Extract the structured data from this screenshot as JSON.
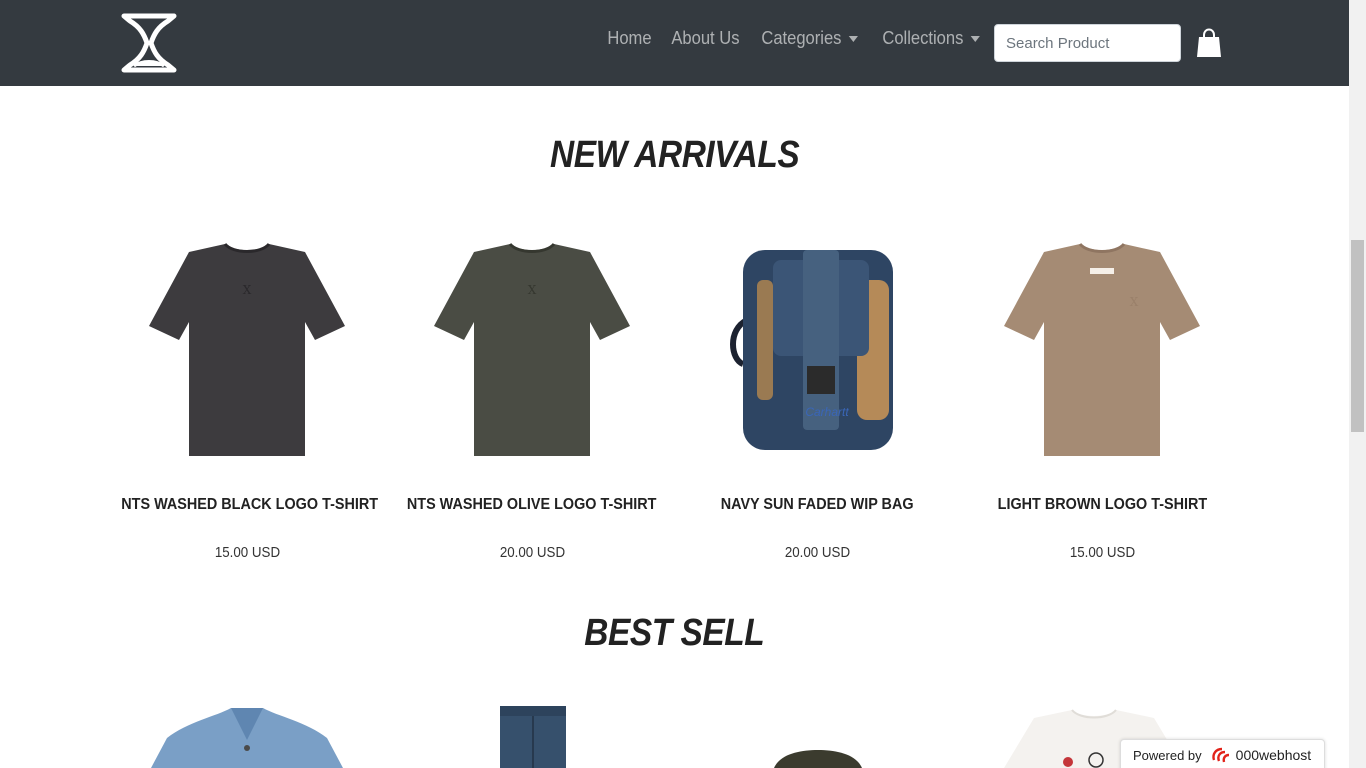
{
  "navbar": {
    "links": [
      {
        "label": "Home",
        "dropdown": false
      },
      {
        "label": "About Us",
        "dropdown": false
      },
      {
        "label": "Categories",
        "dropdown": true
      },
      {
        "label": "Collections",
        "dropdown": true
      }
    ],
    "search_placeholder": "Search Product"
  },
  "new_arrivals": {
    "title": "NEW ARRIVALS",
    "products": [
      {
        "name": "NTS WASHED BLACK LOGO T-SHIRT",
        "price": "15.00 USD",
        "color": "#3d3b3e"
      },
      {
        "name": "NTS WASHED OLIVE LOGO T-SHIRT",
        "price": "20.00 USD",
        "color": "#4a4c44"
      },
      {
        "name": "NAVY SUN FADED WIP BAG",
        "price": "20.00 USD",
        "color": "#2e4563"
      },
      {
        "name": "LIGHT BROWN LOGO T-SHIRT",
        "price": "15.00 USD",
        "color": "#a58b74"
      }
    ]
  },
  "best_sell": {
    "title": "BEST SELL"
  },
  "badge": {
    "powered": "Powered by",
    "brand": "000webhost"
  },
  "colors": {
    "navbar": "#343a40",
    "nav_link": "rgba(255,255,255,0.6)"
  }
}
